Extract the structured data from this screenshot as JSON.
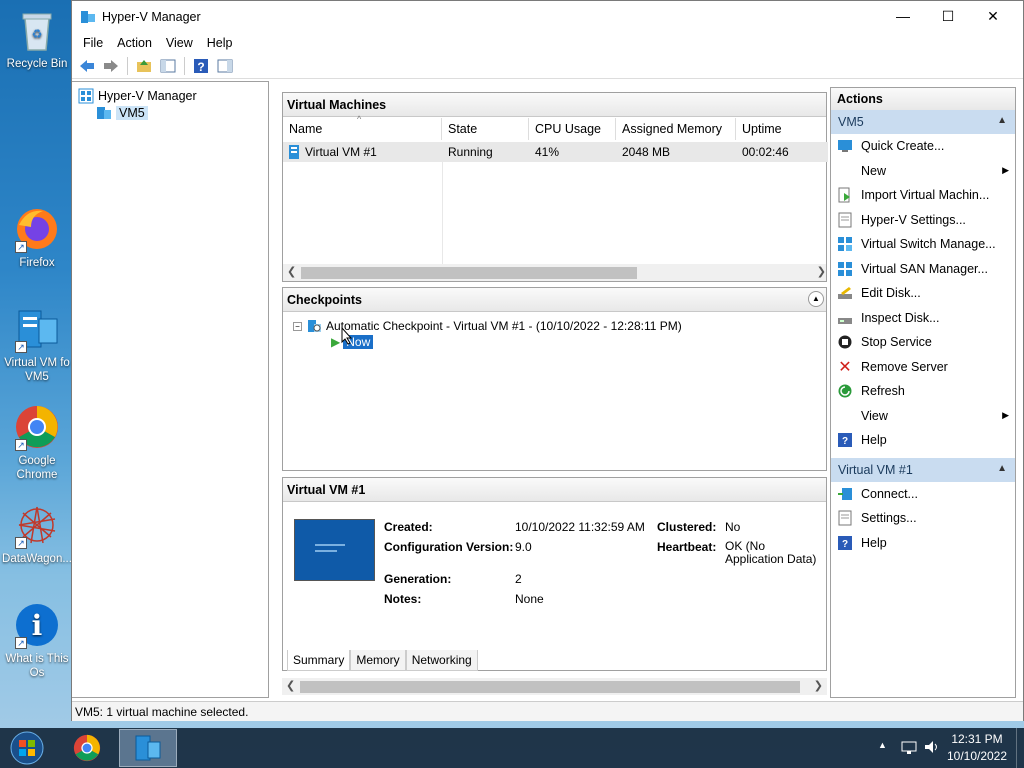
{
  "desktop": {
    "icons": [
      {
        "label": "Recycle Bin"
      },
      {
        "label": "Firefox"
      },
      {
        "label": "Virtual VM fo VM5"
      },
      {
        "label": "Google Chrome"
      },
      {
        "label": "DataWagon..."
      },
      {
        "label": "What is This Os"
      }
    ]
  },
  "window": {
    "title": "Hyper-V Manager",
    "menu": [
      "File",
      "Action",
      "View",
      "Help"
    ]
  },
  "tree": {
    "root": "Hyper-V Manager",
    "child": "VM5"
  },
  "virtual_machines": {
    "header": "Virtual Machines",
    "columns": [
      "Name",
      "State",
      "CPU Usage",
      "Assigned Memory",
      "Uptime"
    ],
    "rows": [
      {
        "name": "Virtual VM #1",
        "state": "Running",
        "cpu": "41%",
        "memory": "2048 MB",
        "uptime": "00:02:46"
      }
    ]
  },
  "checkpoints": {
    "header": "Checkpoints",
    "item": "Automatic Checkpoint - Virtual VM #1 - (10/10/2022 - 12:28:11 PM)",
    "now": "Now"
  },
  "details": {
    "header": "Virtual VM #1",
    "created_label": "Created:",
    "created_value": "10/10/2022 11:32:59 AM",
    "config_label": "Configuration Version:",
    "config_value": "9.0",
    "generation_label": "Generation:",
    "generation_value": "2",
    "notes_label": "Notes:",
    "notes_value": "None",
    "clustered_label": "Clustered:",
    "clustered_value": "No",
    "heartbeat_label": "Heartbeat:",
    "heartbeat_value": "OK (No Application Data)",
    "tabs": [
      "Summary",
      "Memory",
      "Networking"
    ]
  },
  "actions": {
    "header": "Actions",
    "section1": "VM5",
    "section1_items": [
      "Quick Create...",
      "New",
      "Import Virtual Machin...",
      "Hyper-V Settings...",
      "Virtual Switch Manage...",
      "Virtual SAN Manager...",
      "Edit Disk...",
      "Inspect Disk...",
      "Stop Service",
      "Remove Server",
      "Refresh",
      "View",
      "Help"
    ],
    "section2": "Virtual VM #1",
    "section2_items": [
      "Connect...",
      "Settings...",
      "Help"
    ]
  },
  "status": "VM5:  1 virtual machine selected.",
  "taskbar": {
    "time": "12:31 PM",
    "date": "10/10/2022"
  }
}
